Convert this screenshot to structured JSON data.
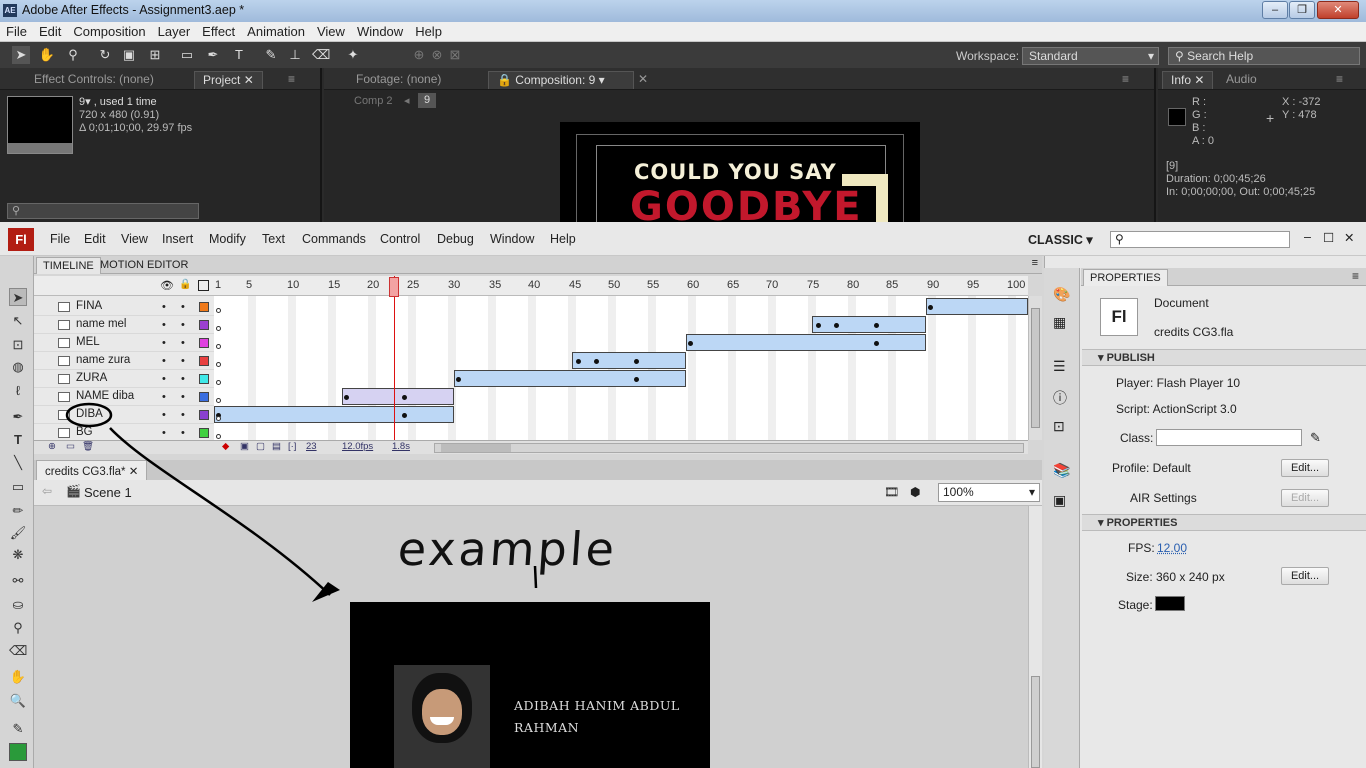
{
  "ae": {
    "title": "Adobe After Effects - Assignment3.aep *",
    "logo": "AE",
    "menu": [
      "File",
      "Edit",
      "Composition",
      "Layer",
      "Effect",
      "Animation",
      "View",
      "Window",
      "Help"
    ],
    "workspace_label": "Workspace:",
    "workspace_value": "Standard",
    "search_help": "Search Help",
    "panels": {
      "effect_controls_tab": "Effect Controls: (none)",
      "project_tab": "Project",
      "project_item_name": "9▾ , used 1 time",
      "project_item_size": "720 x 480 (0.91)",
      "project_item_duration": "Δ 0;01;10;00, 29.97 fps",
      "footage_tab": "Footage: (none)",
      "composition_tab": "Composition: 9",
      "comp_breadcrumb_prev": "Comp 2",
      "comp_breadcrumb_current": "9",
      "comp_title_line1": "COULD YOU SAY",
      "comp_title_line2": "GOODBYE",
      "info_tab": "Info",
      "audio_tab": "Audio",
      "info_r": "R :",
      "info_g": "G :",
      "info_b": "B :",
      "info_a": "A : 0",
      "info_x": "X : -372",
      "info_y": "Y : 478",
      "info_layer": "[9]",
      "info_duration": "Duration: 0;00;45;26",
      "info_inout": "In: 0;00;00;00, Out: 0;00;45;25"
    }
  },
  "flash": {
    "logo": "Fl",
    "menu": [
      "File",
      "Edit",
      "View",
      "Insert",
      "Modify",
      "Text",
      "Commands",
      "Control",
      "Debug",
      "Window",
      "Help"
    ],
    "workspace": "CLASSIC",
    "timeline_tab": "TIMELINE",
    "motion_editor_tab": "MOTION EDITOR",
    "ruler_numbers": [
      "1",
      "5",
      "10",
      "15",
      "20",
      "25",
      "30",
      "35",
      "40",
      "45",
      "50",
      "55",
      "60",
      "65",
      "70",
      "75",
      "80",
      "85",
      "90",
      "95",
      "100"
    ],
    "layers": [
      {
        "name": "FINA",
        "color": "#f07a1a"
      },
      {
        "name": "name mel",
        "color": "#9b3fd1"
      },
      {
        "name": "MEL",
        "color": "#e040e0"
      },
      {
        "name": "name zura",
        "color": "#e84040"
      },
      {
        "name": "ZURA",
        "color": "#40e8e8"
      },
      {
        "name": "NAME diba",
        "color": "#3a6ee0"
      },
      {
        "name": "DIBA",
        "color": "#8a40d0"
      },
      {
        "name": "BG",
        "color": "#40d040"
      }
    ],
    "timeline_footer": {
      "frame": "23",
      "fps": "12.0fps",
      "time": "1.8s"
    },
    "doc_tab": "credits CG3.fla*",
    "scene": "Scene 1",
    "zoom": "100%",
    "annotation": "example",
    "stage_text_line1": "ADIBAH HANIM ABDUL",
    "stage_text_line2": "RAHMAN",
    "properties": {
      "tab": "PROPERTIES",
      "doc_type": "Document",
      "doc_name": "credits CG3.fla",
      "publish_header": "PUBLISH",
      "player": "Player: Flash Player 10",
      "script": "Script: ActionScript 3.0",
      "class_label": "Class:",
      "profile": "Profile: Default",
      "air": "AIR Settings",
      "edit": "Edit...",
      "properties_header": "PROPERTIES",
      "fps_label": "FPS:",
      "fps_value": "12.00",
      "size": "Size: 360 x 240 px",
      "stage_label": "Stage:"
    }
  },
  "colors": {
    "flash_red": "#b21d13",
    "tween_blue": "#bcd7f5",
    "playhead": "#dd1111"
  }
}
